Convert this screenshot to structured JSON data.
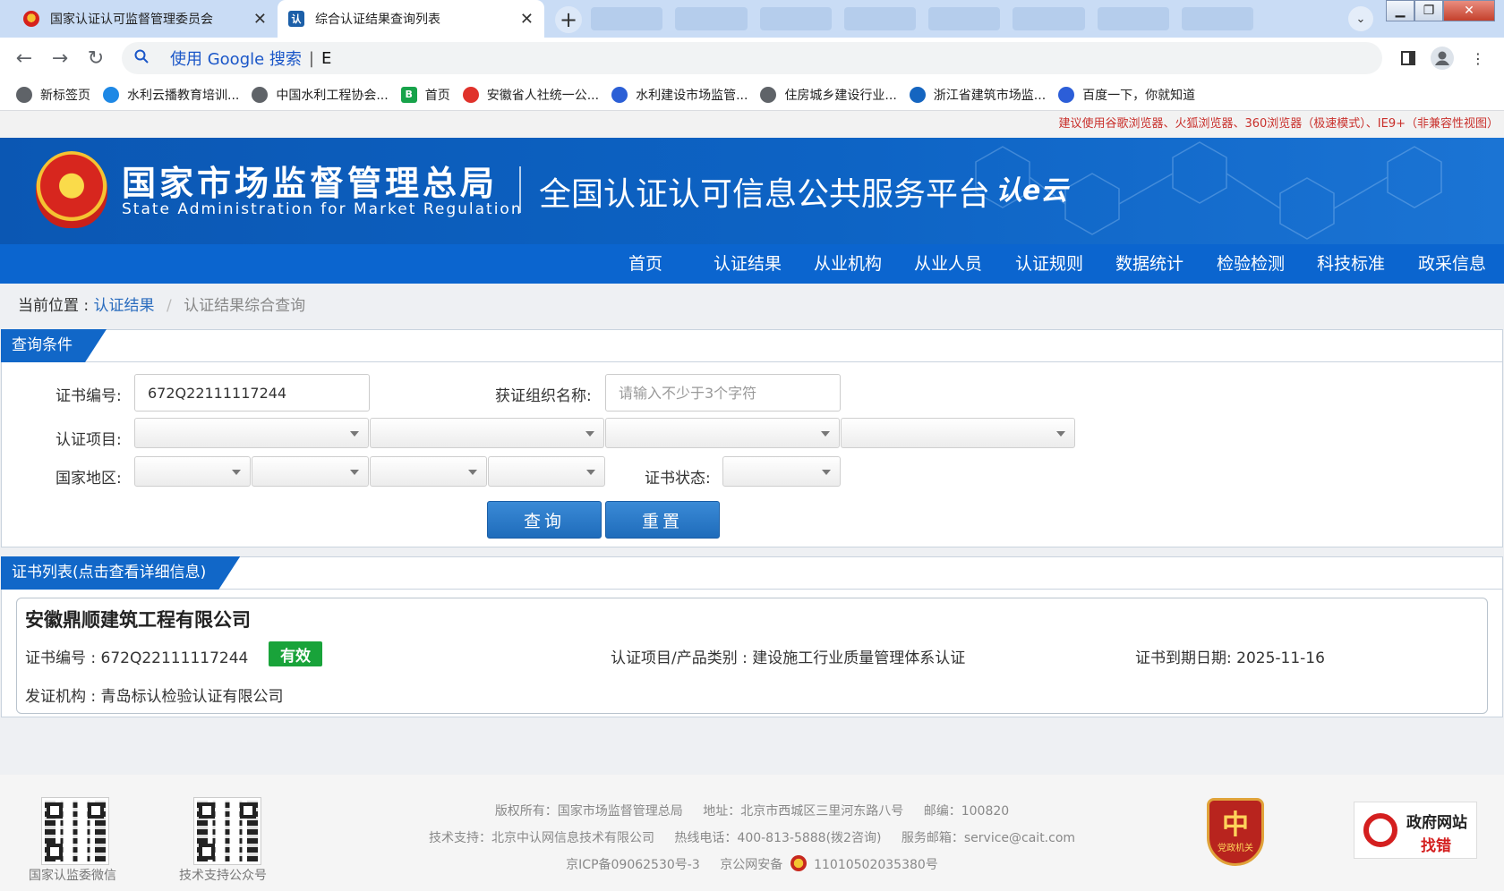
{
  "browser": {
    "tabs": [
      {
        "title": "国家认证认可监督管理委员会",
        "close": "✕"
      },
      {
        "title": "综合认证结果查询列表",
        "close": "✕"
      }
    ],
    "new_tab": "+",
    "address": {
      "search_label": "使用 Google 搜索",
      "separator": "|",
      "typed": "E"
    },
    "bookmarks": [
      {
        "label": "新标签页",
        "icon": "globe-icon",
        "color": "#5f6368"
      },
      {
        "label": "水利云播教育培训...",
        "icon": "water-icon",
        "color": "#1e88e5"
      },
      {
        "label": "中国水利工程协会...",
        "icon": "globe-icon",
        "color": "#5f6368"
      },
      {
        "label": "首页",
        "icon": "b-icon",
        "color": "#17a34a"
      },
      {
        "label": "安徽省人社统一公...",
        "icon": "red-icon",
        "color": "#e0322b"
      },
      {
        "label": "水利建设市场监管...",
        "icon": "blue-icon",
        "color": "#2b5fd6"
      },
      {
        "label": "住房城乡建设行业...",
        "icon": "globe-icon",
        "color": "#5f6368"
      },
      {
        "label": "浙江省建筑市场监...",
        "icon": "zj-icon",
        "color": "#1565c0"
      },
      {
        "label": "百度一下，你就知道",
        "icon": "baidu-icon",
        "color": "#2c5ed8"
      }
    ]
  },
  "notice": "建议使用谷歌浏览器、火狐浏览器、360浏览器（极速模式）、IE9+（非兼容性视图）",
  "header": {
    "org_cn": "国家市场监督管理总局",
    "org_en": "State Administration  for  Market Regulation",
    "platform": "全国认证认可信息公共服务平台",
    "logo": "认e云"
  },
  "nav": [
    "首页",
    "认证结果",
    "从业机构",
    "从业人员",
    "认证规则",
    "数据统计",
    "检验检测",
    "科技标准",
    "政采信息"
  ],
  "breadcrumb": {
    "prefix": "当前位置 :",
    "link": "认证结果",
    "divider": "/",
    "current": "认证结果综合查询"
  },
  "query": {
    "title": "查询条件",
    "cert_no_label": "证书编号:",
    "cert_no_value": "672Q22111117244",
    "org_label": "获证组织名称:",
    "org_placeholder": "请输入不少于3个字符",
    "project_label": "认证项目:",
    "region_label": "国家地区:",
    "status_label": "证书状态:",
    "search_btn": "查询",
    "reset_btn": "重置"
  },
  "results": {
    "title": "证书列表(点击查看详细信息)",
    "items": [
      {
        "company": "安徽鼎顺建筑工程有限公司",
        "cert_no": "证书编号 : 672Q22111117244",
        "status": "有效",
        "project": "认证项目/产品类别 : 建设施工行业质量管理体系认证",
        "expiry": "证书到期日期: 2025-11-16",
        "issuer": "发证机构 : 青岛标认检验认证有限公司"
      }
    ]
  },
  "footer": {
    "qr1_caption": "国家认监委微信",
    "qr2_caption": "技术支持公众号",
    "line1": [
      "版权所有：国家市场监督管理总局",
      "地址：北京市西城区三里河东路八号",
      "邮编：100820"
    ],
    "line2": [
      "技术支持：北京中认网信息技术有限公司",
      "热线电话：400-813-5888(拨2咨询)",
      "服务邮箱：service@cait.com"
    ],
    "line3": [
      "京ICP备09062530号-3",
      "京公网安备",
      "11010502035380号"
    ],
    "party_badge": "党政机关",
    "gov_site_top": "政府网站",
    "gov_site_bottom": "找错"
  },
  "colors": {
    "brand_blue": "#0b65cf",
    "valid_green": "#19a33a",
    "notice_red": "#c9302c"
  }
}
